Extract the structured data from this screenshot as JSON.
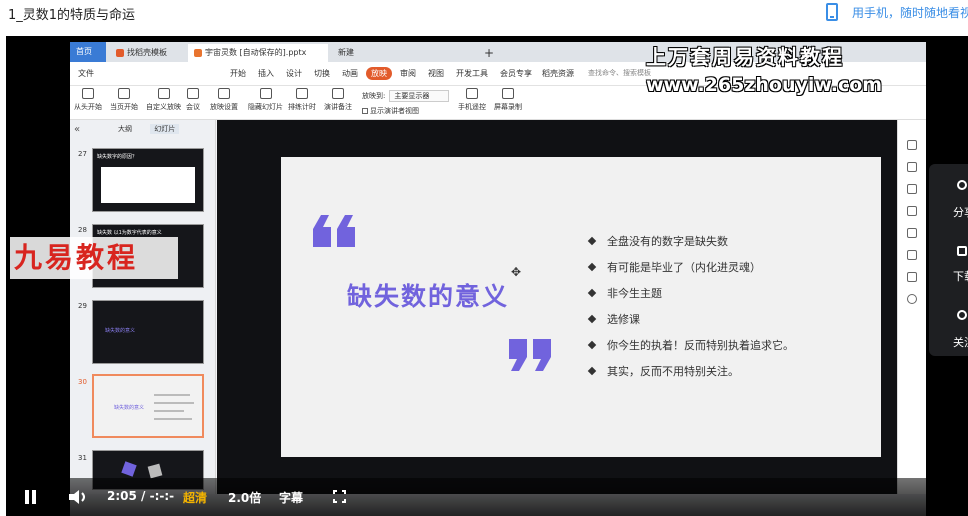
{
  "page": {
    "title": "1_灵数1的特质与命运",
    "mobile_link": "用手机，随时随地看视"
  },
  "wps": {
    "tabs": {
      "home": "首页",
      "template": "找稻壳模板",
      "document": "宇宙灵数 [自动保存的].pptx",
      "new": "新建",
      "plus": "+"
    },
    "menu": [
      "文件",
      "开始",
      "插入",
      "设计",
      "切换",
      "动画",
      "放映",
      "审阅",
      "视图",
      "开发工具",
      "会员专享",
      "稻壳资源"
    ],
    "menu_active": "放映",
    "search": "查找命令、搜索模板",
    "ribbon": {
      "from_start": "从头开始",
      "from_current": "当页开始",
      "custom": "自定义放映",
      "meeting": "会议",
      "setup": "放映设置",
      "hide": "隐藏幻灯片",
      "rehearse": "排练计时",
      "narration": "演讲备注",
      "show_on_label": "放映到:",
      "show_on_value": "主要显示器",
      "presenter_view": "显示演讲者视图",
      "phone_remote": "手机遥控",
      "record": "屏幕录制"
    },
    "panel_tabs": [
      "大纲",
      "幻灯片"
    ],
    "thumbnails": [
      {
        "num": "27",
        "title": "缺失数字的原因？"
      },
      {
        "num": "28",
        "title": "缺失数 以1为数字代表的意义"
      },
      {
        "num": "29",
        "title": "缺失数的意义"
      },
      {
        "num": "30",
        "title": "缺失数的意义"
      },
      {
        "num": "31",
        "title": ""
      }
    ]
  },
  "slide": {
    "title": "缺失数的意义",
    "bullets": [
      "全盘没有的数字是缺失数",
      "有可能是毕业了（内化进灵魂）",
      "非今生主题",
      "选修课",
      "你今生的执着！反而特别执着追求它。",
      "其实，反而不用特别关注。"
    ]
  },
  "watermarks": {
    "top": "上万套周易资料教程",
    "url": "www.265zhouyiw.com",
    "left": "九易教程"
  },
  "side_panel": [
    "分享",
    "下载",
    "关注"
  ],
  "controls": {
    "time": "2:05 / -:-:-",
    "quality": "超清",
    "speed": "2.0倍",
    "subtitle": "字幕"
  },
  "colors": {
    "slide_accent": "#7163dd",
    "active_tab": "#e25b2b",
    "link": "#3a8ee6",
    "quality": "#f4b400"
  }
}
